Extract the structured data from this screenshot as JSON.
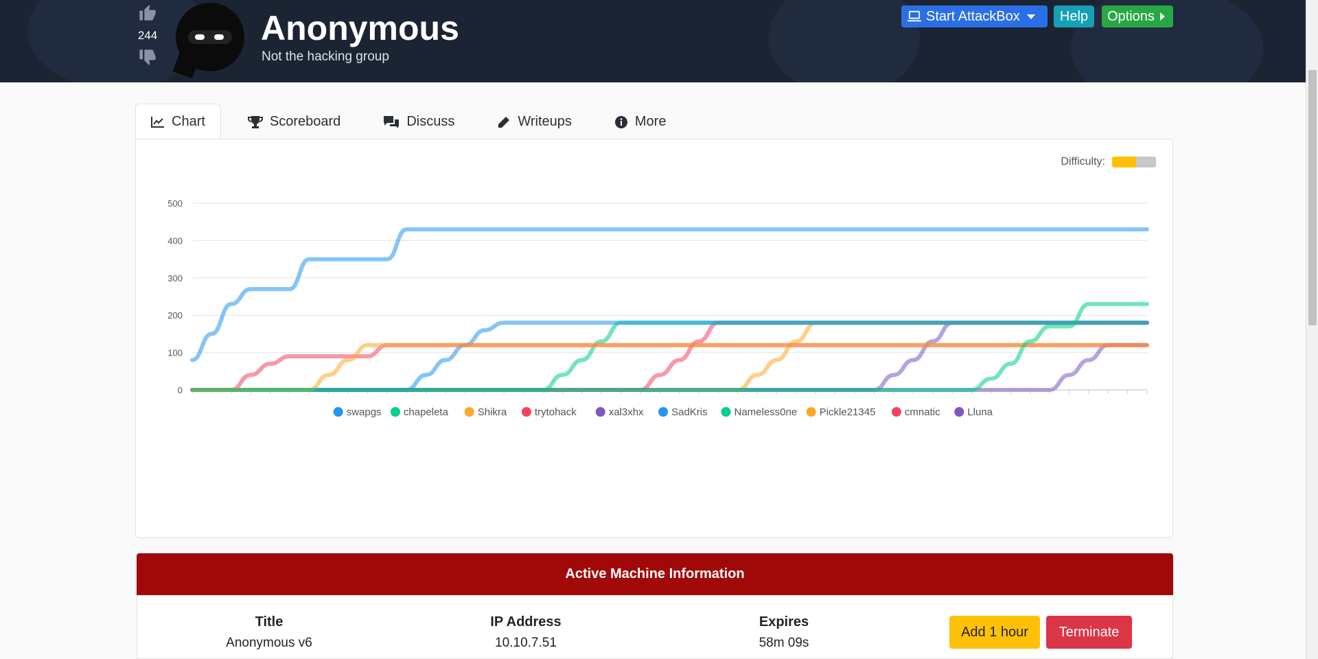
{
  "header": {
    "title": "Anonymous",
    "subtitle": "Not the hacking group",
    "votes": "244",
    "buttons": {
      "attackbox": "Start AttackBox",
      "help": "Help",
      "options": "Options"
    }
  },
  "tabs": [
    {
      "label": "Chart",
      "icon": "chart-line-icon",
      "active": true
    },
    {
      "label": "Scoreboard",
      "icon": "trophy-icon"
    },
    {
      "label": "Discuss",
      "icon": "comments-icon"
    },
    {
      "label": "Writeups",
      "icon": "pen-icon"
    },
    {
      "label": "More",
      "icon": "info-circle-icon"
    }
  ],
  "difficulty": {
    "label": "Difficulty:",
    "level": 0.55,
    "color": "#ffc107"
  },
  "chart_data": {
    "type": "line",
    "ylim": [
      0,
      500
    ],
    "yticks": [
      0,
      100,
      200,
      300,
      400,
      500
    ],
    "x_points": 50,
    "legend_position": "bottom",
    "grid": true,
    "series": [
      {
        "name": "swapgs",
        "color": "#2196f3",
        "start": 0,
        "steps": [
          [
            0,
            80
          ],
          [
            1,
            150
          ],
          [
            2,
            230
          ],
          [
            3,
            270
          ],
          [
            6,
            350
          ],
          [
            11,
            430
          ]
        ]
      },
      {
        "name": "chapeleta",
        "color": "#00d084",
        "start": 40,
        "steps": [
          [
            41,
            30
          ],
          [
            42,
            70
          ],
          [
            43,
            130
          ],
          [
            44,
            170
          ],
          [
            46,
            230
          ]
        ]
      },
      {
        "name": "Shikra",
        "color": "#ffa726",
        "start": 6,
        "steps": [
          [
            7,
            40
          ],
          [
            8,
            80
          ],
          [
            9,
            120
          ]
        ]
      },
      {
        "name": "trytohack",
        "color": "#f44361",
        "start": 2,
        "steps": [
          [
            3,
            40
          ],
          [
            4,
            70
          ],
          [
            5,
            90
          ],
          [
            10,
            120
          ]
        ]
      },
      {
        "name": "xal3xhx",
        "color": "#7e57c2",
        "start": 44,
        "steps": [
          [
            45,
            40
          ],
          [
            46,
            80
          ],
          [
            47,
            120
          ]
        ]
      },
      {
        "name": "SadKris",
        "color": "#2196f3",
        "start": 11,
        "steps": [
          [
            12,
            40
          ],
          [
            13,
            80
          ],
          [
            14,
            120
          ],
          [
            15,
            160
          ],
          [
            16,
            180
          ]
        ]
      },
      {
        "name": "Nameless0ne",
        "color": "#00d084",
        "start": 18,
        "steps": [
          [
            19,
            40
          ],
          [
            20,
            80
          ],
          [
            21,
            130
          ],
          [
            22,
            180
          ]
        ]
      },
      {
        "name": "Pickle21345",
        "color": "#ffa726",
        "start": 28,
        "steps": [
          [
            29,
            40
          ],
          [
            30,
            80
          ],
          [
            31,
            130
          ],
          [
            32,
            180
          ]
        ]
      },
      {
        "name": "cmnatic",
        "color": "#f44361",
        "start": 23,
        "steps": [
          [
            24,
            40
          ],
          [
            25,
            80
          ],
          [
            26,
            130
          ],
          [
            27,
            180
          ]
        ]
      },
      {
        "name": "Lluna",
        "color": "#7e57c2",
        "start": 35,
        "steps": [
          [
            36,
            40
          ],
          [
            37,
            80
          ],
          [
            38,
            130
          ],
          [
            39,
            180
          ]
        ]
      }
    ]
  },
  "machine": {
    "heading": "Active Machine Information",
    "title_label": "Title",
    "title_value": "Anonymous v6",
    "ip_label": "IP Address",
    "ip_value": "10.10.7.51",
    "expires_label": "Expires",
    "expires_value": "58m 09s",
    "add_label": "Add 1 hour",
    "terminate_label": "Terminate"
  }
}
